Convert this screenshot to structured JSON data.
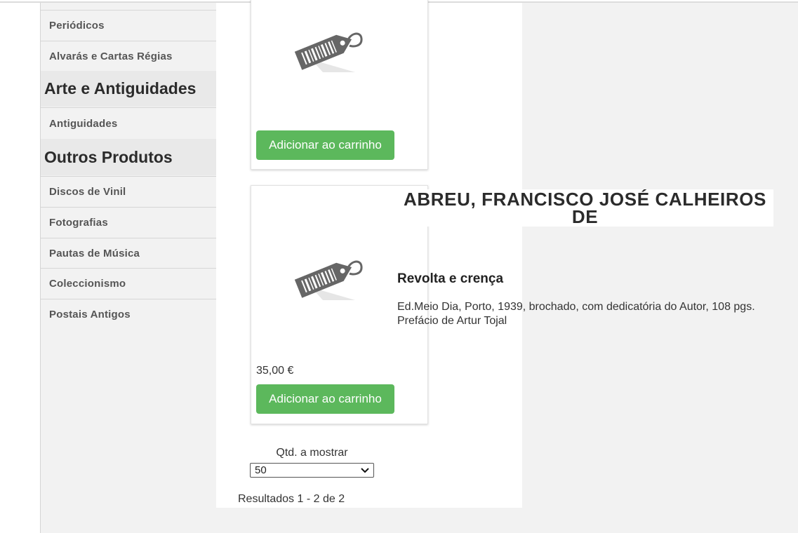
{
  "sidebar": {
    "items_top": [
      "Periódicos",
      "Alvarás e Cartas Régias"
    ],
    "heading_arte": "Arte e Antiguidades",
    "items_arte": [
      "Antiguidades"
    ],
    "heading_outros": "Outros Produtos",
    "items_outros": [
      "Discos de Vinil",
      "Fotografias",
      "Pautas de Música",
      "Coleccionismo",
      "Postais Antigos"
    ]
  },
  "products": [
    {
      "image_icon": "price-tag-icon",
      "add_button": "Adicionar ao carrinho"
    },
    {
      "image_icon": "price-tag-icon",
      "author": "ABREU, FRANCISCO JOSÉ CALHEIROS DE",
      "title": "Revolta e crença",
      "description": "Ed.Meio Dia, Porto, 1939, brochado, com dedicatória do Autor, 108 pgs. Prefácio de Artur Tojal",
      "price": "35,00 €",
      "add_button": "Adicionar ao carrinho"
    }
  ],
  "pagination": {
    "qty_label": "Qtd. a mostrar",
    "qty_value": "50",
    "results_text": "Resultados 1 - 2 de 2"
  },
  "colors": {
    "button_green": "#5cb85c",
    "sidebar_bg": "#f2f2f2"
  }
}
